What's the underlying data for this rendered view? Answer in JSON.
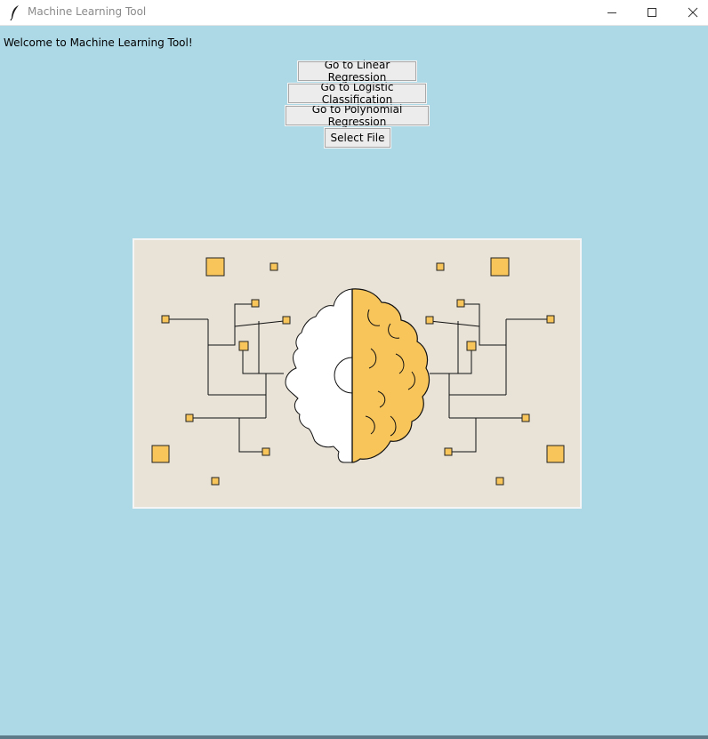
{
  "window": {
    "title": "Machine Learning Tool",
    "icon": "feather-icon",
    "controls": [
      "minimize-icon",
      "maximize-icon",
      "close-icon"
    ]
  },
  "main": {
    "welcome": "Welcome to Machine Learning Tool!",
    "buttons": {
      "linear": "Go to Linear Regression",
      "logistic": "Go to Logistic Classification",
      "polynomial": "Go to Polynomial Regression",
      "select_file": "Select File"
    },
    "illustration": {
      "subject": "ai-brain-gear-circuit-image",
      "background": "#e8e2d7",
      "accent": "#f8c55a"
    }
  },
  "colors": {
    "window_bg": "#add8e6",
    "button_bg": "#ececec"
  }
}
